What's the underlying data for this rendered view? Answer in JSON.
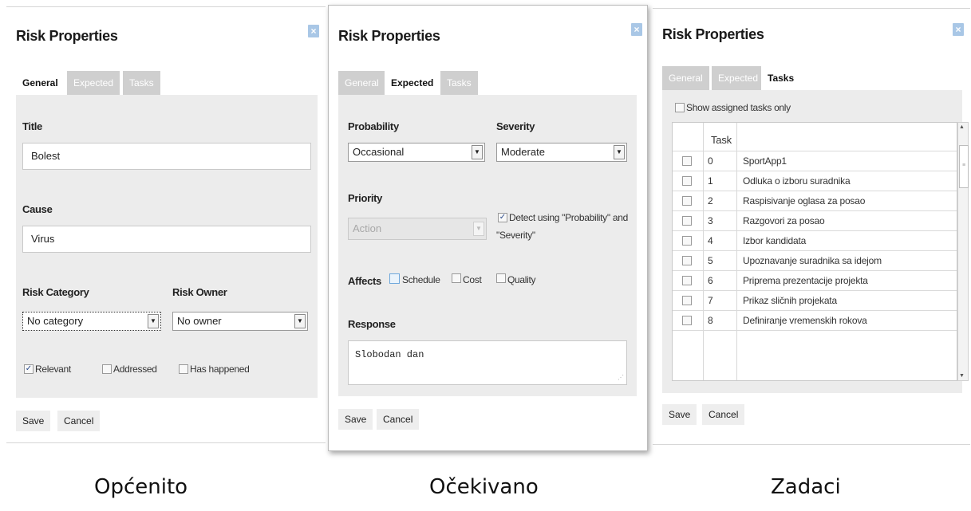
{
  "dialog_title": "Risk Properties",
  "close_symbol": "×",
  "tabs": {
    "general": "General",
    "expected": "Expected",
    "tasks": "Tasks"
  },
  "buttons": {
    "save": "Save",
    "cancel": "Cancel"
  },
  "general": {
    "title_label": "Title",
    "title_value": "Bolest",
    "cause_label": "Cause",
    "cause_value": "Virus",
    "category_label": "Risk Category",
    "category_value": "No category",
    "owner_label": "Risk Owner",
    "owner_value": "No owner",
    "relevant_label": "Relevant",
    "relevant_checked": true,
    "addressed_label": "Addressed",
    "addressed_checked": false,
    "happened_label": "Has happened",
    "happened_checked": false
  },
  "expected": {
    "probability_label": "Probability",
    "probability_value": "Occasional",
    "severity_label": "Severity",
    "severity_value": "Moderate",
    "priority_label": "Priority",
    "priority_value": "Action",
    "detect_label_line1": "Detect using \"Probability\" and",
    "detect_label_line2": "\"Severity\"",
    "detect_checked": true,
    "affects_label": "Affects",
    "schedule_label": "Schedule",
    "cost_label": "Cost",
    "quality_label": "Quality",
    "response_label": "Response",
    "response_value": "Slobodan dan"
  },
  "tasks_tab": {
    "show_assigned_label": "Show assigned tasks only",
    "column_task": "Task",
    "rows": [
      {
        "id": "0",
        "name": "SportApp1"
      },
      {
        "id": "1",
        "name": "Odluka o izboru suradnika"
      },
      {
        "id": "2",
        "name": "Raspisivanje oglasa za posao"
      },
      {
        "id": "3",
        "name": "Razgovori za posao"
      },
      {
        "id": "4",
        "name": "Izbor kandidata"
      },
      {
        "id": "5",
        "name": "Upoznavanje suradnika sa idejom"
      },
      {
        "id": "6",
        "name": "Priprema prezentacije projekta"
      },
      {
        "id": "7",
        "name": "Prikaz sličnih projekata"
      },
      {
        "id": "8",
        "name": "Definiranje vremenskih rokova"
      }
    ]
  },
  "captions": {
    "left": "Općenito",
    "middle": "Očekivano",
    "right": "Zadaci"
  },
  "colors": {
    "tab_inactive": "#cfcfcf",
    "content_bg": "#ececec",
    "close_bg": "#a9c7e6"
  }
}
